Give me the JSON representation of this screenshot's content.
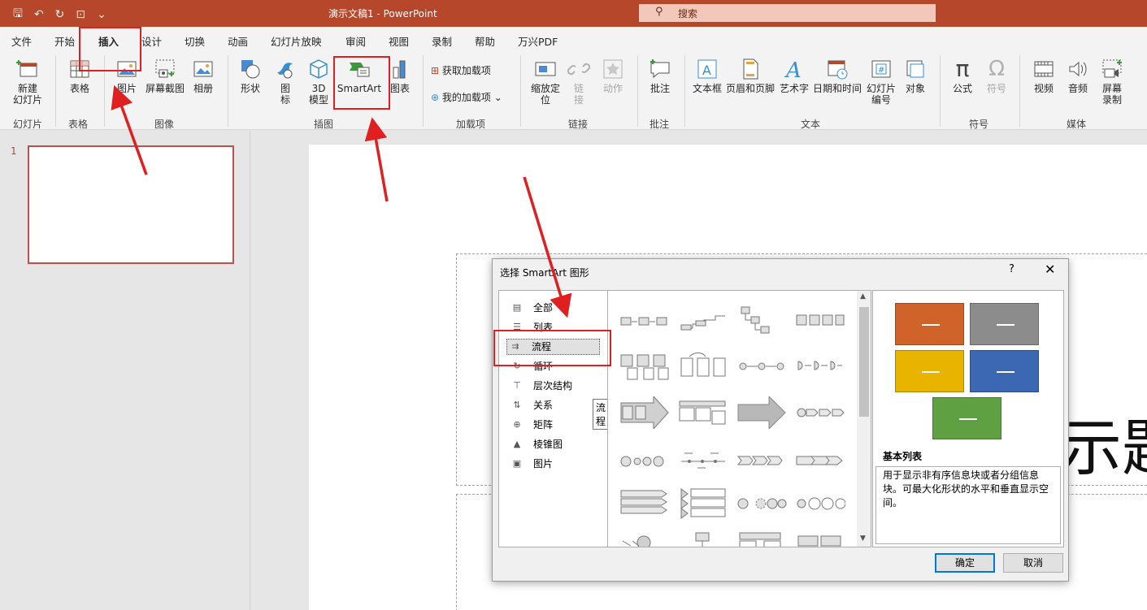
{
  "titlebar": {
    "doc_title": "演示文稿1  -  PowerPoint",
    "search_placeholder": "搜索",
    "qat": {
      "save": "🖫",
      "undo": "↶",
      "redo": "↻",
      "present": "⊡",
      "customize": "⌄"
    }
  },
  "tabs": [
    "文件",
    "开始",
    "插入",
    "设计",
    "切换",
    "动画",
    "幻灯片放映",
    "审阅",
    "视图",
    "录制",
    "帮助",
    "万兴PDF"
  ],
  "active_tab": "插入",
  "ribbon": {
    "new_slide": "新建\n幻灯片",
    "table": "表格",
    "picture": "图片",
    "screenshot": "屏幕截图",
    "album": "相册",
    "shapes": "形状",
    "icons": "图\n标",
    "model3d": "3D\n模型",
    "smartart": "SmartArt",
    "chart": "图表",
    "get_addins": "获取加载项",
    "my_addins": "我的加载项",
    "zoom": "缩放定\n位",
    "link": "链\n接",
    "action": "动作",
    "comment": "批注",
    "textbox": "文本框",
    "header_footer": "页眉和页脚",
    "wordart": "艺术字",
    "datetime": "日期和时间",
    "slide_number": "幻灯片\n编号",
    "object": "对象",
    "equation": "公式",
    "symbol": "符号",
    "video": "视频",
    "audio": "音频",
    "screen_record": "屏幕\n录制",
    "groups": {
      "slides": "幻灯片",
      "tables": "表格",
      "images": "图像",
      "illustrations": "插图",
      "addins": "加载项",
      "links": "链接",
      "comments": "批注",
      "text": "文本",
      "symbols": "符号",
      "media": "媒体"
    }
  },
  "slides_panel": {
    "slide_number": "1"
  },
  "canvas": {
    "visible_text": "示题"
  },
  "dialog": {
    "title": "选择 SmartArt 图形",
    "help": "?",
    "close": "✕",
    "categories": [
      {
        "label": "全部",
        "icon": "all-icon"
      },
      {
        "label": "列表",
        "icon": "list-icon"
      },
      {
        "label": "流程",
        "icon": "process-icon"
      },
      {
        "label": "循环",
        "icon": "cycle-icon"
      },
      {
        "label": "层次结构",
        "icon": "hierarchy-icon"
      },
      {
        "label": "关系",
        "icon": "relationship-icon"
      },
      {
        "label": "矩阵",
        "icon": "matrix-icon"
      },
      {
        "label": "棱锥图",
        "icon": "pyramid-icon"
      },
      {
        "label": "图片",
        "icon": "picture-icon"
      }
    ],
    "selected_category": "流程",
    "tooltip": "流程",
    "preview_title": "基本列表",
    "preview_desc": "用于显示非有序信息块或者分组信息块。可最大化形状的水平和垂直显示空间。",
    "preview_colors": [
      "#d0632a",
      "#8c8c8c",
      "#e8b400",
      "#3c67b2",
      "#5fa043"
    ],
    "ok": "确定",
    "cancel": "取消"
  },
  "annotation_color": "#e02020"
}
